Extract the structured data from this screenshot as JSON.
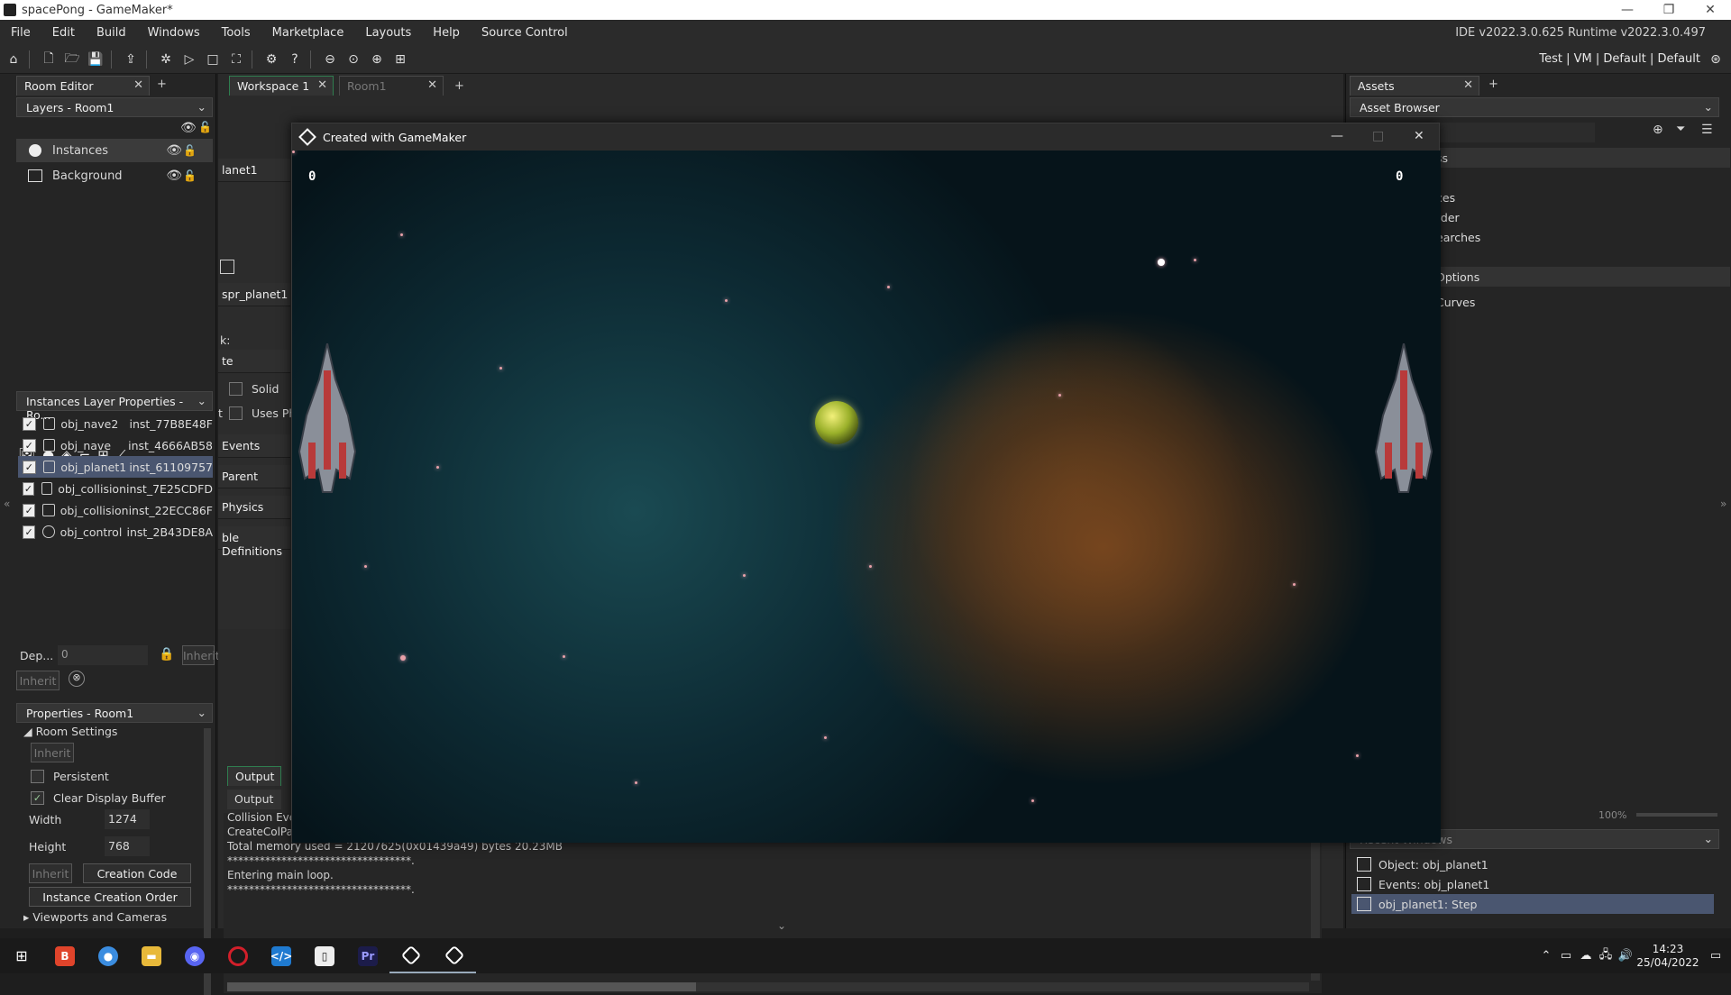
{
  "window": {
    "title": "spacePong - GameMaker*",
    "minimize": "—",
    "maximize": "❐",
    "close": "✕"
  },
  "menu": {
    "items": [
      "File",
      "Edit",
      "Build",
      "Windows",
      "Tools",
      "Marketplace",
      "Layouts",
      "Help",
      "Source Control"
    ],
    "ide_version": "IDE v2022.3.0.625  Runtime v2022.3.0.497"
  },
  "toolbar": {
    "target": "Test  |  VM  |  Default  |  Default"
  },
  "left": {
    "tab_room_editor": "Room Editor",
    "tab_add": "+",
    "layers_dropdown": "Layers - Room1",
    "layers": [
      {
        "label": "Instances",
        "icon": "instances-layer-icon"
      },
      {
        "label": "Background",
        "icon": "background-layer-icon"
      }
    ],
    "inst_dropdown": "Instances Layer Properties - Ro...",
    "instances": [
      {
        "obj": "obj_nave2",
        "inst": "inst_77B8E48F",
        "checked": true
      },
      {
        "obj": "obj_nave",
        "inst": "inst_4666AB58",
        "checked": true
      },
      {
        "obj": "obj_planet1",
        "inst": "inst_61109757",
        "checked": true
      },
      {
        "obj": "obj_collision",
        "inst": "inst_7E25CDFD",
        "checked": true
      },
      {
        "obj": "obj_collision",
        "inst": "inst_22ECC86F",
        "checked": true
      },
      {
        "obj": "obj_control",
        "inst": "inst_2B43DE8A",
        "checked": true
      }
    ],
    "depth_label": "Dep...",
    "depth_value": "0",
    "inherit": "Inherit",
    "props_dropdown": "Properties - Room1",
    "room_settings": "Room Settings",
    "persistent": "Persistent",
    "clear_display_buffer": "Clear Display Buffer",
    "width_label": "Width",
    "width_value": "1274",
    "height_label": "Height",
    "height_value": "768",
    "creation_code": "Creation Code",
    "instance_creation_order": "Instance Creation Order",
    "viewports": "Viewports and Cameras"
  },
  "middle": {
    "tab_workspace": "Workspace 1",
    "tab_room": "Room1",
    "tab_add": "+",
    "obj_name": "lanet1",
    "sprite_name": "spr_planet1",
    "mask_label": "k:",
    "te_label": "te",
    "solid": "Solid",
    "uses_physics": "Uses Ph",
    "t_label": "t",
    "events": "Events",
    "parent": "Parent",
    "physics": "Physics",
    "variable_definitions": "ble Definitions",
    "output_tab": "Output",
    "output_sub": "Output",
    "output_lines": [
      "Collision Eve",
      "CreateColPa",
      "Total memory used = 21207625(0x01439a49) bytes 20.23MB",
      "**********************************.",
      "Entering main loop.",
      "**********************************."
    ]
  },
  "right": {
    "tab_assets": "Assets",
    "tab_add": "+",
    "asset_browser": "Asset Browser",
    "asset_items": [
      "ss",
      "ces",
      "rder",
      "earches",
      "Options",
      "Curves"
    ],
    "zoom": "100%",
    "recent_header": "Recent Windows",
    "recent": [
      {
        "label": "Object: obj_planet1",
        "icon": "object-icon"
      },
      {
        "label": "Events: obj_planet1",
        "icon": "events-flag-icon"
      },
      {
        "label": "obj_planet1: Step",
        "icon": "step-flag-icon",
        "selected": true
      }
    ]
  },
  "game": {
    "title": "Created with GameMaker",
    "score_left": "0",
    "score_right": "0"
  },
  "taskbar": {
    "time": "14:23",
    "date": "25/04/2022",
    "apps": [
      "windows-start",
      "brave-browser",
      "chrome",
      "file-explorer",
      "discord",
      "opera",
      "vscode",
      "twitch",
      "premiere-pro",
      "gamemaker",
      "gamemaker-runner"
    ]
  }
}
